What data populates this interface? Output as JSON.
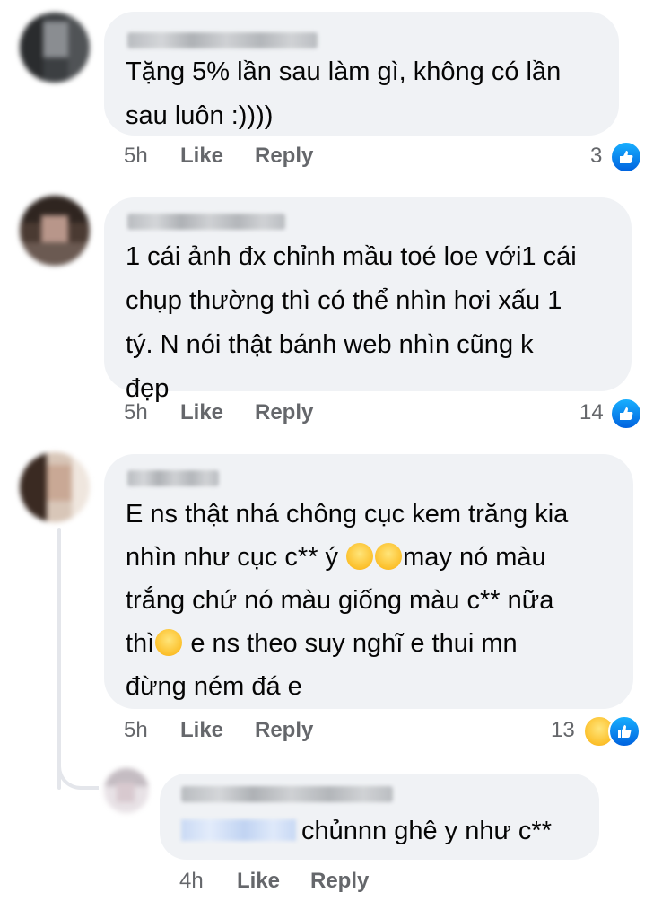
{
  "actions": {
    "like": "Like",
    "reply": "Reply"
  },
  "comments": [
    {
      "lines": [
        "Tặng 5% lần sau làm gì, không có lần",
        "sau luôn :))))"
      ],
      "time": "5h",
      "reaction_count": "3",
      "reactions": [
        "like-icon"
      ]
    },
    {
      "lines": [
        "1 cái ảnh đx chỉnh mầu toé loe với1 cái",
        "chụp thường thì có thể nhìn hơi xấu 1",
        "tý. N nói thật bánh web nhìn cũng k",
        "đẹp"
      ],
      "time": "5h",
      "reaction_count": "14",
      "reactions": [
        "like-icon"
      ]
    },
    {
      "lines": [
        "E ns thật nhá chông cục kem trăng kia",
        "nhìn như cục c** ý",
        "may nó màu",
        "trắng chứ nó màu giống màu c** nữa",
        "thì",
        "e ns theo suy nghĩ e thui mn",
        "đừng ném đá e"
      ],
      "time": "5h",
      "reaction_count": "13",
      "reactions": [
        "haha-icon",
        "like-icon"
      ]
    }
  ],
  "reply": {
    "text": "chủnnn ghê y như c**",
    "time": "4h"
  },
  "colors": {
    "bubble": "#f0f2f5",
    "text": "#050505",
    "meta": "#65676b",
    "like_blue": "#1877f2",
    "thread_line": "#e4e6eb"
  }
}
